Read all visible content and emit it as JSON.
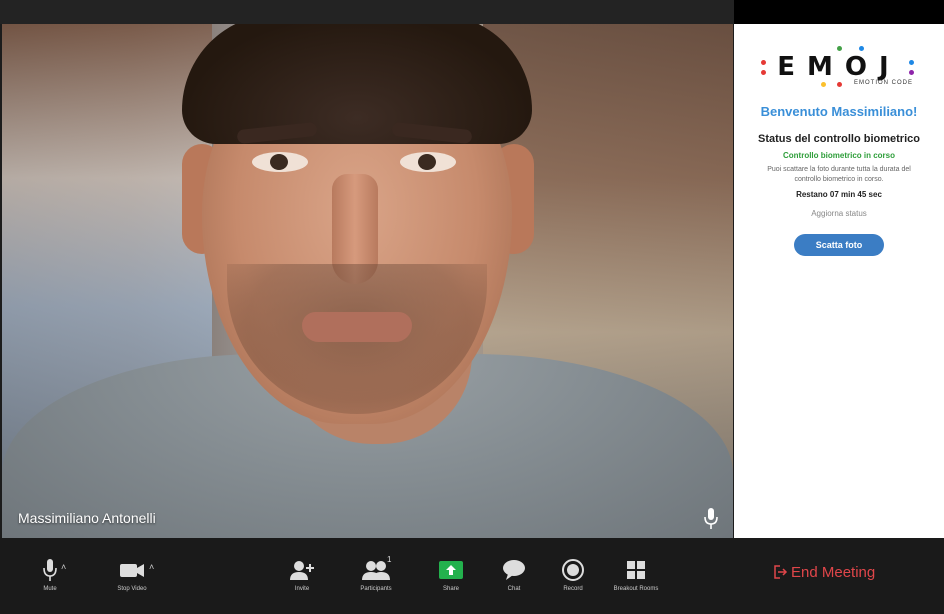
{
  "video": {
    "participant_name": "Massimiliano Antonelli"
  },
  "panel": {
    "logo": {
      "text": "EMOJ",
      "subtitle": "EMOTION CODE",
      "dot_colors": [
        "#e53935",
        "#43a047",
        "#1e88e5",
        "#fbc02d",
        "#8e24aa"
      ]
    },
    "welcome": "Benvenuto Massimiliano!",
    "status_title": "Status del controllo biometrico",
    "status_value": "Controllo biometrico in corso",
    "status_description": "Puoi scattare la foto durante tutta la durata del controllo biometrico in corso.",
    "remaining": "Restano 07 min 45 sec",
    "refresh_link": "Aggiorna status",
    "photo_button": "Scatta foto"
  },
  "toolbar": {
    "mute": "Mute",
    "stop_video": "Stop Video",
    "invite": "Invite",
    "participants": "Participants",
    "participants_count": "1",
    "share": "Share",
    "chat": "Chat",
    "record": "Record",
    "breakout_rooms": "Breakout Rooms",
    "end_meeting": "End Meeting"
  },
  "colors": {
    "accent_blue": "#3b7dc4",
    "welcome_blue": "#3a8fd8",
    "status_green": "#2e9e3a",
    "share_green": "#23b14d",
    "end_red": "#e0464a"
  }
}
